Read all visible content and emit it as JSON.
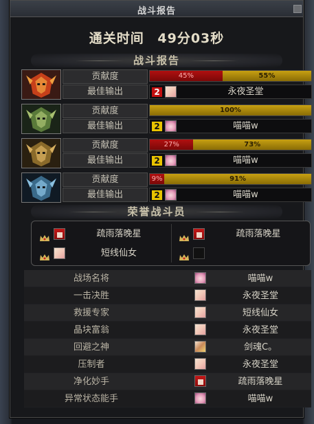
{
  "window": {
    "title": "战斗报告"
  },
  "clear_time": {
    "label": "通关时间",
    "value": "49分03秒"
  },
  "sections": {
    "battle_report": "战斗报告",
    "honor_fighters": "荣誉战斗员"
  },
  "labels": {
    "contribution": "贡献度",
    "best_dps": "最佳输出"
  },
  "bosses": [
    {
      "icon": "red-flame-boss-icon",
      "segments": [
        {
          "text": "45%",
          "pct": 45,
          "color": "red"
        },
        {
          "text": "55%",
          "pct": 55,
          "color": "gold"
        }
      ],
      "best": {
        "rank": "2",
        "avatar": "white",
        "name": "永夜圣堂"
      }
    },
    {
      "icon": "green-armor-boss-icon",
      "segments": [
        {
          "text": "100%",
          "pct": 100,
          "color": "gold"
        }
      ],
      "best": {
        "rank": "2",
        "avatar": "pink",
        "name": "喵喵w"
      }
    },
    {
      "icon": "gold-armor-boss-icon",
      "segments": [
        {
          "text": "27%",
          "pct": 27,
          "color": "red"
        },
        {
          "text": "73%",
          "pct": 73,
          "color": "gold"
        }
      ],
      "best": {
        "rank": "2",
        "avatar": "pink",
        "name": "喵喵w"
      }
    },
    {
      "icon": "blue-armor-boss-icon",
      "segments": [
        {
          "text": "9%",
          "pct": 9,
          "color": "red"
        },
        {
          "text": "91%",
          "pct": 91,
          "color": "gold"
        }
      ],
      "best": {
        "rank": "2",
        "avatar": "pink",
        "name": "喵喵w"
      }
    }
  ],
  "honor": [
    {
      "avatar": "red",
      "name": "疏雨落晚星"
    },
    {
      "avatar": "red",
      "name": "疏雨落晚星"
    },
    {
      "avatar": "white",
      "name": "短线仙女"
    },
    {
      "avatar": "empty",
      "name": ""
    }
  ],
  "awards": [
    {
      "title": "战场名将",
      "avatar": "pink",
      "name": "喵喵w"
    },
    {
      "title": "一击决胜",
      "avatar": "white",
      "name": "永夜圣堂"
    },
    {
      "title": "救援专家",
      "avatar": "white",
      "name": "短线仙女"
    },
    {
      "title": "晶块富翁",
      "avatar": "white",
      "name": "永夜圣堂"
    },
    {
      "title": "回避之神",
      "avatar": "mix",
      "name": "剑魂C。"
    },
    {
      "title": "压制者",
      "avatar": "white",
      "name": "永夜圣堂"
    },
    {
      "title": "净化妙手",
      "avatar": "red",
      "name": "疏雨落晚星"
    },
    {
      "title": "异常状态能手",
      "avatar": "pink",
      "name": "喵喵w"
    }
  ],
  "colors": {
    "red_bar": "#b01010",
    "gold_bar": "#c7a012",
    "rank_red": "#c21010",
    "rank_gold": "#e8c300"
  }
}
